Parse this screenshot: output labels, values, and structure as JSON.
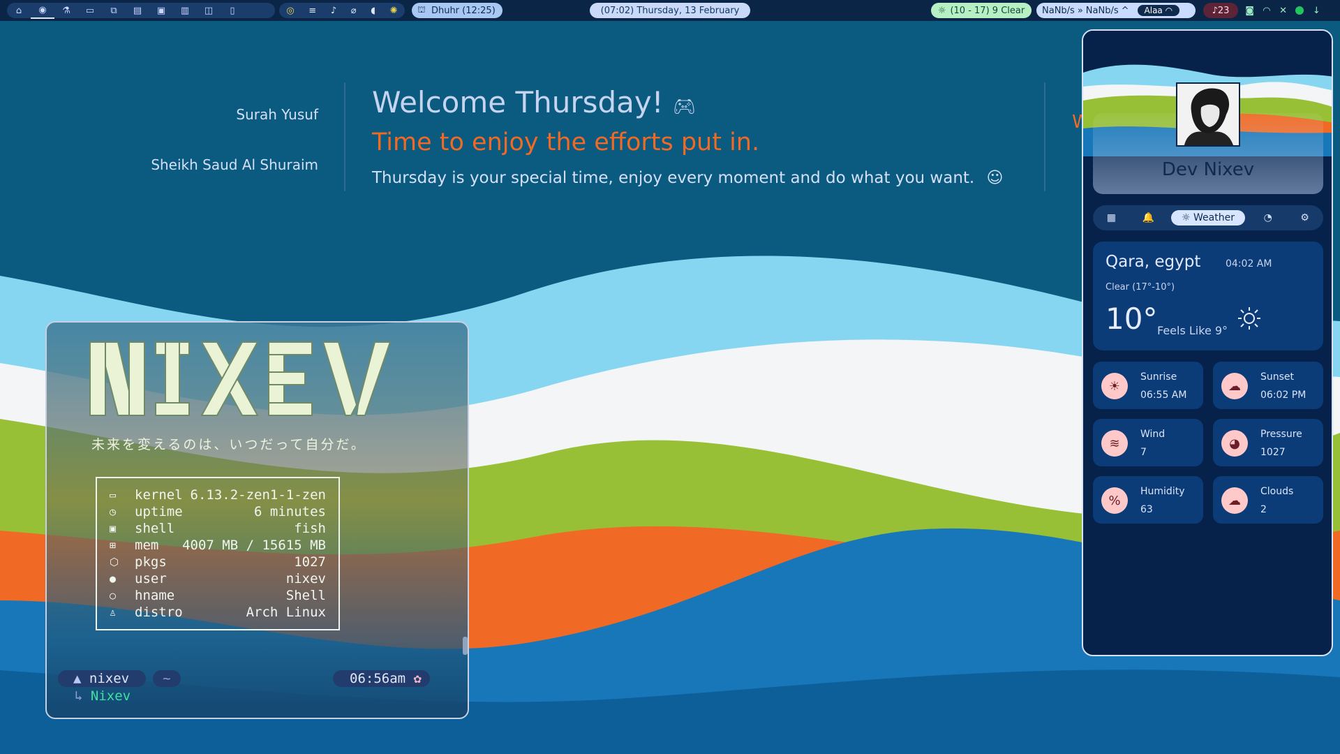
{
  "topbar": {
    "workspaces": [
      "home-icon",
      "arch-icon",
      "flask-icon",
      "folder-icon",
      "files-icon",
      "chat-icon",
      "app-icon",
      "terminal-icon",
      "doc-icon",
      "pen-icon"
    ],
    "media_icons": [
      "record-icon",
      "list-icon",
      "music-icon",
      "mic-icon",
      "volume-icon",
      "brightness-icon"
    ],
    "prayer": "Dhuhr (12:25)",
    "clock": "(07:02) Thursday, 13 February",
    "weather": "(10 - 17) 9 Clear",
    "net_down": "NaNb/s",
    "net_up": "NaNb/s",
    "wifi_name": "Alaa",
    "notifications": "23"
  },
  "header": {
    "surah": "Surah Yusuf",
    "reciter": "Sheikh Saud Al Shuraim",
    "welcome_title": "Welcome Thursday!",
    "welcome_sub": "Time to enjoy the efforts put in.",
    "welcome_body": "Thursday is your special time, enjoy every moment and do what you want.",
    "cut_letter": "W"
  },
  "terminal": {
    "logo": "NIXEV",
    "tagline": "未来を変えるのは、いつだって自分だ。",
    "fetch": [
      {
        "icon": "laptop-icon",
        "glyph": "▭",
        "key": "kernel",
        "value": "6.13.2-zen1-1-zen"
      },
      {
        "icon": "clock-icon",
        "glyph": "◷",
        "key": "uptime",
        "value": "6 minutes"
      },
      {
        "icon": "shell-icon",
        "glyph": "▣",
        "key": "shell",
        "value": "fish"
      },
      {
        "icon": "chip-icon",
        "glyph": "⊞",
        "key": "mem",
        "value": "4007 MB / 15615 MB"
      },
      {
        "icon": "package-icon",
        "glyph": "⬡",
        "key": "pkgs",
        "value": "1027"
      },
      {
        "icon": "user-icon",
        "glyph": "●",
        "key": "user",
        "value": "nixev"
      },
      {
        "icon": "host-icon",
        "glyph": "○",
        "key": "hname",
        "value": "Shell"
      },
      {
        "icon": "linux-icon",
        "glyph": "♙",
        "key": "distro",
        "value": "Arch Linux"
      }
    ],
    "prompt_user": "nixev",
    "prompt_dir": "~",
    "prompt_time": "06:56am",
    "prompt_line2": "Nixev"
  },
  "panel": {
    "username": "Dev Nixev",
    "tabs": [
      {
        "icon": "grid-icon",
        "glyph": "▦",
        "label": ""
      },
      {
        "icon": "bell-icon",
        "glyph": "🔔",
        "label": ""
      },
      {
        "icon": "sun-icon",
        "glyph": "☼",
        "label": "Weather"
      },
      {
        "icon": "pie-icon",
        "glyph": "◔",
        "label": ""
      },
      {
        "icon": "network-icon",
        "glyph": "⚙",
        "label": ""
      }
    ],
    "weather": {
      "city": "Qara, egypt",
      "time": "04:02 AM",
      "desc": "Clear (17°-10°)",
      "temp": "10°",
      "feels": "Feels Like 9°"
    },
    "stats": [
      {
        "name": "sunrise",
        "icon": "sunrise-icon",
        "glyph": "☀",
        "label": "Sunrise",
        "value": "06:55 AM"
      },
      {
        "name": "sunset",
        "icon": "sunset-icon",
        "glyph": "☁",
        "label": "Sunset",
        "value": "06:02 PM"
      },
      {
        "name": "wind",
        "icon": "wind-icon",
        "glyph": "≋",
        "label": "Wind",
        "value": "7"
      },
      {
        "name": "pressure",
        "icon": "gauge-icon",
        "glyph": "◕",
        "label": "Pressure",
        "value": "1027"
      },
      {
        "name": "humidity",
        "icon": "humidity-icon",
        "glyph": "%",
        "label": "Humidity",
        "value": "63"
      },
      {
        "name": "clouds",
        "icon": "cloud-icon",
        "glyph": "☁",
        "label": "Clouds",
        "value": "2"
      }
    ]
  },
  "colors": {
    "accent_orange": "#f06a26",
    "bar_bg": "#0b2547",
    "panel_bg": "#06224b",
    "card_bg": "#0b3c78"
  }
}
